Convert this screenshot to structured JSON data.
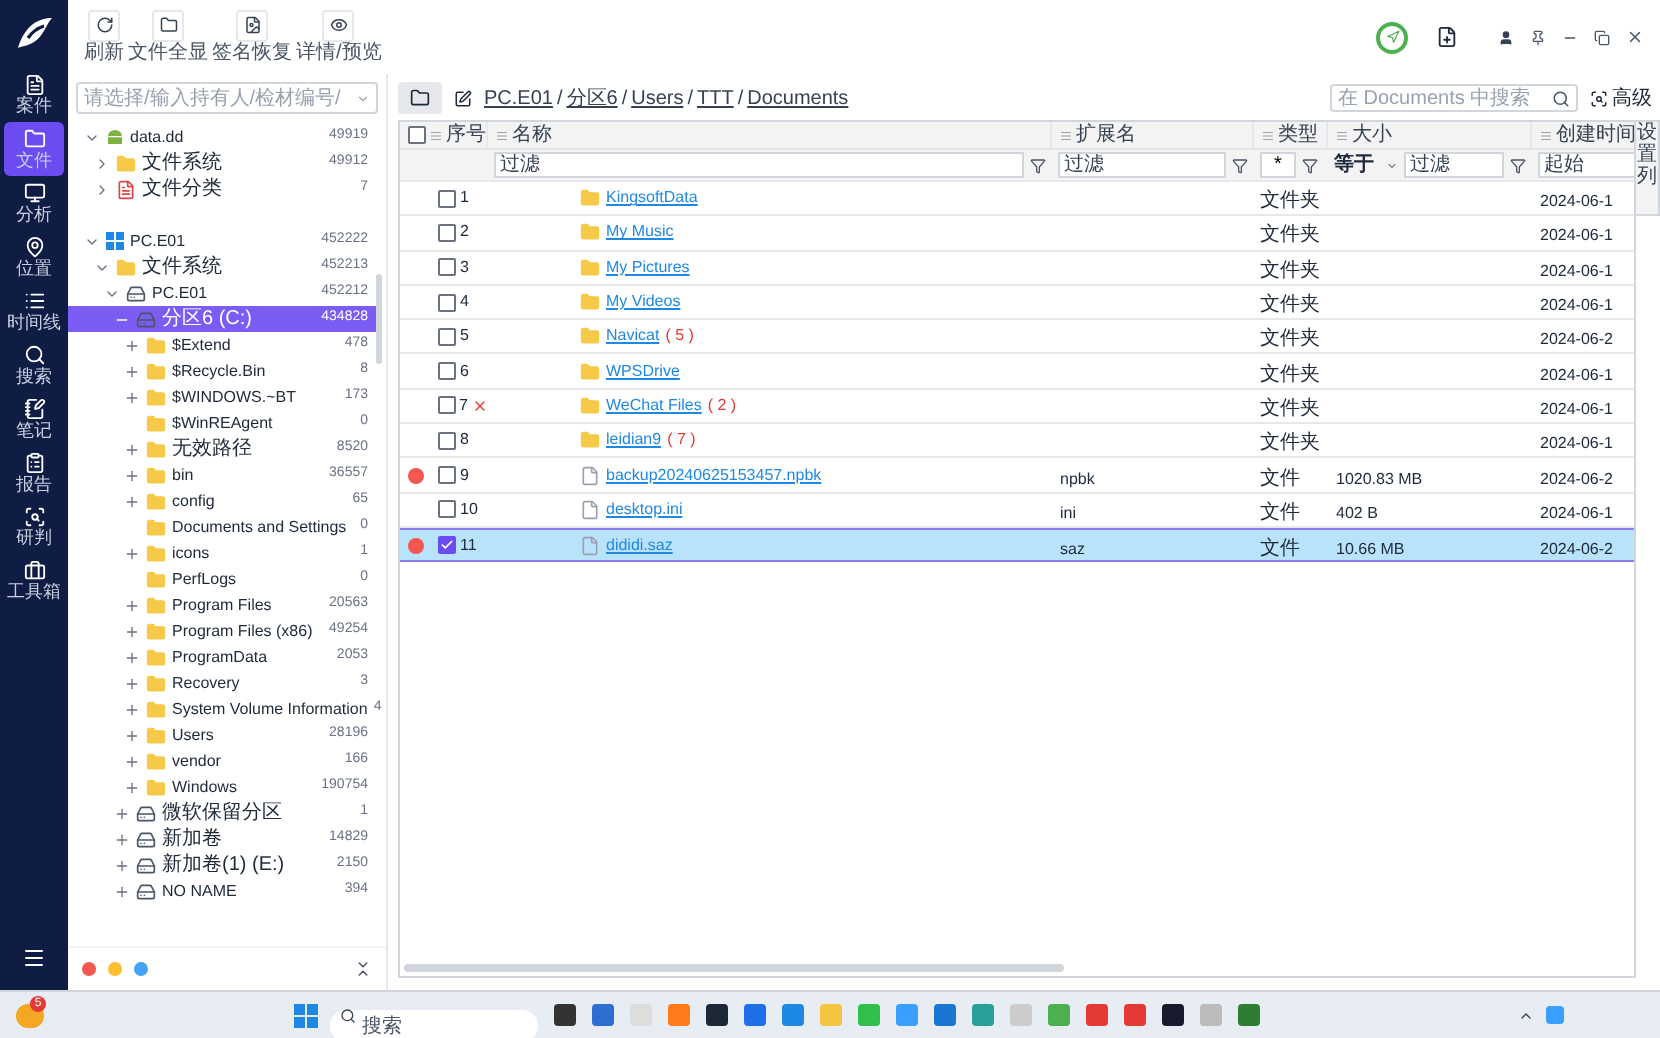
{
  "nav": [
    {
      "label": "案件",
      "selected": false
    },
    {
      "label": "文件",
      "selected": true
    },
    {
      "label": "分析",
      "selected": false
    },
    {
      "label": "位置",
      "selected": false
    },
    {
      "label": "时间线",
      "selected": false
    },
    {
      "label": "搜索",
      "selected": false
    },
    {
      "label": "笔记",
      "selected": false
    },
    {
      "label": "报告",
      "selected": false
    },
    {
      "label": "研判",
      "selected": false
    },
    {
      "label": "工具箱",
      "selected": false
    }
  ],
  "toolbar": [
    "刷新",
    "文件全显",
    "签名恢复",
    "详情/预览"
  ],
  "holder_select": {
    "placeholder": "请选择/输入持有人/检材编号/"
  },
  "tree": [
    {
      "name": "data.dd",
      "count": "49919",
      "kind": "android_image",
      "expanded": true,
      "selected": false,
      "children": [
        {
          "name": "文件系统",
          "count": "49912",
          "kind": "folder",
          "expanded": false,
          "selected": false
        },
        {
          "name": "文件分类",
          "count": "7",
          "kind": "category",
          "expanded": false,
          "selected": false
        }
      ]
    },
    {
      "name": "PC.E01",
      "count": "452222",
      "kind": "windows_image",
      "expanded": true,
      "selected": false,
      "children": [
        {
          "name": "文件系统",
          "count": "452213",
          "kind": "folder",
          "expanded": true,
          "selected": false,
          "children": [
            {
              "name": "PC.E01",
              "count": "452212",
              "kind": "disk",
              "expanded": true,
              "selected": false,
              "children": [
                {
                  "name": "分区6  (C:)",
                  "count": "434828",
                  "kind": "disk",
                  "expanded": true,
                  "selected": true,
                  "children": [
                    {
                      "name": "$Extend",
                      "count": "478",
                      "kind": "folder",
                      "expanded": false,
                      "selected": false
                    },
                    {
                      "name": "$Recycle.Bin",
                      "count": "8",
                      "kind": "folder",
                      "expanded": false,
                      "selected": false
                    },
                    {
                      "name": "$WINDOWS.~BT",
                      "count": "173",
                      "kind": "folder",
                      "expanded": false,
                      "selected": false
                    },
                    {
                      "name": "$WinREAgent",
                      "count": "0",
                      "kind": "folder",
                      "selected": false
                    },
                    {
                      "name": "无效路径",
                      "count": "8520",
                      "kind": "folder",
                      "expanded": false,
                      "selected": false
                    },
                    {
                      "name": "bin",
                      "count": "36557",
                      "kind": "folder",
                      "expanded": false,
                      "selected": false
                    },
                    {
                      "name": "config",
                      "count": "65",
                      "kind": "folder",
                      "expanded": false,
                      "selected": false
                    },
                    {
                      "name": "Documents and Settings",
                      "count": "0",
                      "kind": "folder",
                      "selected": false
                    },
                    {
                      "name": "icons",
                      "count": "1",
                      "kind": "folder",
                      "expanded": false,
                      "selected": false
                    },
                    {
                      "name": "PerfLogs",
                      "count": "0",
                      "kind": "folder",
                      "selected": false
                    },
                    {
                      "name": "Program Files",
                      "count": "20563",
                      "kind": "folder",
                      "expanded": false,
                      "selected": false
                    },
                    {
                      "name": "Program Files (x86)",
                      "count": "49254",
                      "kind": "folder",
                      "expanded": false,
                      "selected": false
                    },
                    {
                      "name": "ProgramData",
                      "count": "2053",
                      "kind": "folder",
                      "expanded": false,
                      "selected": false
                    },
                    {
                      "name": "Recovery",
                      "count": "3",
                      "kind": "folder",
                      "expanded": false,
                      "selected": false
                    },
                    {
                      "name": "System Volume Information",
                      "count": "4",
                      "kind": "folder",
                      "expanded": false,
                      "selected": false
                    },
                    {
                      "name": "Users",
                      "count": "28196",
                      "kind": "folder",
                      "expanded": false,
                      "selected": false
                    },
                    {
                      "name": "vendor",
                      "count": "166",
                      "kind": "folder",
                      "expanded": false,
                      "selected": false
                    },
                    {
                      "name": "Windows",
                      "count": "190754",
                      "kind": "folder",
                      "expanded": false,
                      "selected": false
                    }
                  ]
                },
                {
                  "name": "微软保留分区",
                  "count": "1",
                  "kind": "disk",
                  "expanded": false,
                  "selected": false
                },
                {
                  "name": "新加卷",
                  "count": "14829",
                  "kind": "disk",
                  "expanded": false,
                  "selected": false
                },
                {
                  "name": "新加卷(1)  (E:)",
                  "count": "2150",
                  "kind": "disk",
                  "expanded": false,
                  "selected": false
                },
                {
                  "name": "NO NAME",
                  "count": "394",
                  "kind": "disk",
                  "expanded": false,
                  "selected": false
                }
              ]
            }
          ]
        }
      ]
    }
  ],
  "tag_filters": [
    {
      "color": "#f4574f"
    },
    {
      "color": "#fbc02d"
    },
    {
      "color": "#42a5f5"
    }
  ],
  "breadcrumb": [
    "PC.E01",
    "分区6",
    "Users",
    "TTT",
    "Documents"
  ],
  "breadcrumb_separator": "/",
  "search": {
    "placeholder": "在 Documents 中搜索"
  },
  "advanced_button": "高级",
  "settings_tab": "设置列",
  "table": {
    "select_all_checked": false,
    "columns": [
      {
        "label": "序号"
      },
      {
        "label": "名称",
        "filter": {
          "placeholder": "过滤"
        }
      },
      {
        "label": "扩展名",
        "filter": {
          "placeholder": "过滤"
        }
      },
      {
        "label": "类型",
        "filter": {
          "value": "*"
        }
      },
      {
        "label": "大小",
        "filter": {
          "operator": "等于",
          "placeholder": "过滤"
        }
      },
      {
        "label": "创建时间",
        "filter": {
          "placeholder": "起始"
        }
      }
    ],
    "rows": [
      {
        "index": "1",
        "kind": "folder",
        "name": "KingsoftData",
        "type": "文件夹",
        "date": "2024-06-1",
        "checked": false,
        "flagged": false,
        "deleted": false,
        "selected": false
      },
      {
        "index": "2",
        "kind": "folder",
        "name": "My Music",
        "type": "文件夹",
        "date": "2024-06-1",
        "checked": false,
        "flagged": false,
        "deleted": false,
        "selected": false
      },
      {
        "index": "3",
        "kind": "folder",
        "name": "My Pictures",
        "type": "文件夹",
        "date": "2024-06-1",
        "checked": false,
        "flagged": false,
        "deleted": false,
        "selected": false
      },
      {
        "index": "4",
        "kind": "folder",
        "name": "My Videos",
        "type": "文件夹",
        "date": "2024-06-1",
        "checked": false,
        "flagged": false,
        "deleted": false,
        "selected": false
      },
      {
        "index": "5",
        "kind": "folder",
        "name": "Navicat",
        "count": "( 5 )",
        "type": "文件夹",
        "date": "2024-06-2",
        "checked": false,
        "flagged": false,
        "deleted": false,
        "selected": false
      },
      {
        "index": "6",
        "kind": "folder",
        "name": "WPSDrive",
        "type": "文件夹",
        "date": "2024-06-1",
        "checked": false,
        "flagged": false,
        "deleted": false,
        "selected": false
      },
      {
        "index": "7",
        "kind": "folder",
        "name": "WeChat Files",
        "count": "( 2 )",
        "type": "文件夹",
        "date": "2024-06-1",
        "checked": false,
        "flagged": false,
        "deleted": true,
        "selected": false
      },
      {
        "index": "8",
        "kind": "folder",
        "name": "leidian9",
        "count": "( 7 )",
        "type": "文件夹",
        "date": "2024-06-1",
        "checked": false,
        "flagged": false,
        "deleted": false,
        "selected": false
      },
      {
        "index": "9",
        "kind": "file",
        "name": "backup20240625153457.npbk",
        "ext": "npbk",
        "type": "文件",
        "size": "1020.83 MB",
        "date": "2024-06-2",
        "checked": false,
        "flagged": true,
        "deleted": false,
        "selected": false
      },
      {
        "index": "10",
        "kind": "file",
        "name": "desktop.ini",
        "ext": "ini",
        "type": "文件",
        "size": "402 B",
        "date": "2024-06-1",
        "checked": false,
        "flagged": false,
        "deleted": false,
        "selected": false
      },
      {
        "index": "11",
        "kind": "file",
        "name": "dididi.saz",
        "ext": "saz",
        "type": "文件",
        "size": "10.66 MB",
        "date": "2024-06-2",
        "checked": true,
        "flagged": true,
        "deleted": false,
        "selected": true
      }
    ]
  },
  "taskbar": {
    "notification_badge": "5",
    "search": {
      "placeholder": "搜索"
    }
  }
}
